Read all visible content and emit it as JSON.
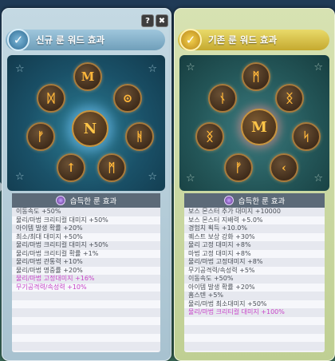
{
  "window": {
    "help_label": "?",
    "close_label": "✖"
  },
  "left": {
    "title": "신규 룬 워드 효과",
    "center_rune": "N",
    "runes": [
      "M",
      "⊙",
      "ᚻ",
      "ᛗ",
      "↑",
      "ᚠ",
      "ᛞ",
      "ᛗ"
    ],
    "list_title": "습득한 룬 효과",
    "effects": [
      {
        "text": "이동속도 +50%",
        "hl": false
      },
      {
        "text": "물리/마법 크리티컬 대미지 +50%",
        "hl": false
      },
      {
        "text": "아이템 발생 확률 +20%",
        "hl": false
      },
      {
        "text": "최소/최대 대미지 +50%",
        "hl": false
      },
      {
        "text": "물리/마법 크리티컬 대미지 +50%",
        "hl": false
      },
      {
        "text": "물리/마법 크리티컬 확률 +1%",
        "hl": false
      },
      {
        "text": "물리/마법 관통력 +10%",
        "hl": false
      },
      {
        "text": "물리/마법 명중률 +20%",
        "hl": false
      },
      {
        "text": "물리/마법 고정대미지 +16%",
        "hl": true
      },
      {
        "text": "무기공격력/속성력 +10%",
        "hl": true
      },
      {
        "text": "",
        "hl": false
      },
      {
        "text": "",
        "hl": false
      },
      {
        "text": "",
        "hl": false
      },
      {
        "text": "",
        "hl": false
      },
      {
        "text": "",
        "hl": false
      },
      {
        "text": "",
        "hl": false
      },
      {
        "text": "",
        "hl": false
      }
    ]
  },
  "right": {
    "title": "기존 룬 워드 효과",
    "center_rune": "M",
    "runes": [
      "ᛗ",
      "ᛝ",
      "ᛋ",
      "‹",
      "ᚠ",
      "ᛝ",
      "ᚾ",
      "ᛝ"
    ],
    "list_title": "습득한 룬 효과",
    "effects": [
      {
        "text": "보스 몬스터 추가 대미지 +10000",
        "hl": false
      },
      {
        "text": "보스 몬스터 지배력 +5.0%",
        "hl": false
      },
      {
        "text": "경험치 획득 +10.0%",
        "hl": false
      },
      {
        "text": "퀘스트 보상 강화 +30%",
        "hl": false
      },
      {
        "text": "물리 고정 대미지 +8%",
        "hl": false
      },
      {
        "text": "마법 고정 대미지 +8%",
        "hl": false
      },
      {
        "text": "물리/마법 고정대미지 +8%",
        "hl": false
      },
      {
        "text": "무기공격력/속성력 +5%",
        "hl": false
      },
      {
        "text": "이동속도 +50%",
        "hl": false
      },
      {
        "text": "아이템 발생 확률 +20%",
        "hl": false
      },
      {
        "text": "홈스텐 +5%",
        "hl": false
      },
      {
        "text": "물리/마법 최소대미지 +50%",
        "hl": false
      },
      {
        "text": "물리/마법 크리티컬 대미지 +100%",
        "hl": true
      },
      {
        "text": "",
        "hl": false
      },
      {
        "text": "",
        "hl": false
      },
      {
        "text": "",
        "hl": false
      },
      {
        "text": "",
        "hl": false
      }
    ]
  }
}
